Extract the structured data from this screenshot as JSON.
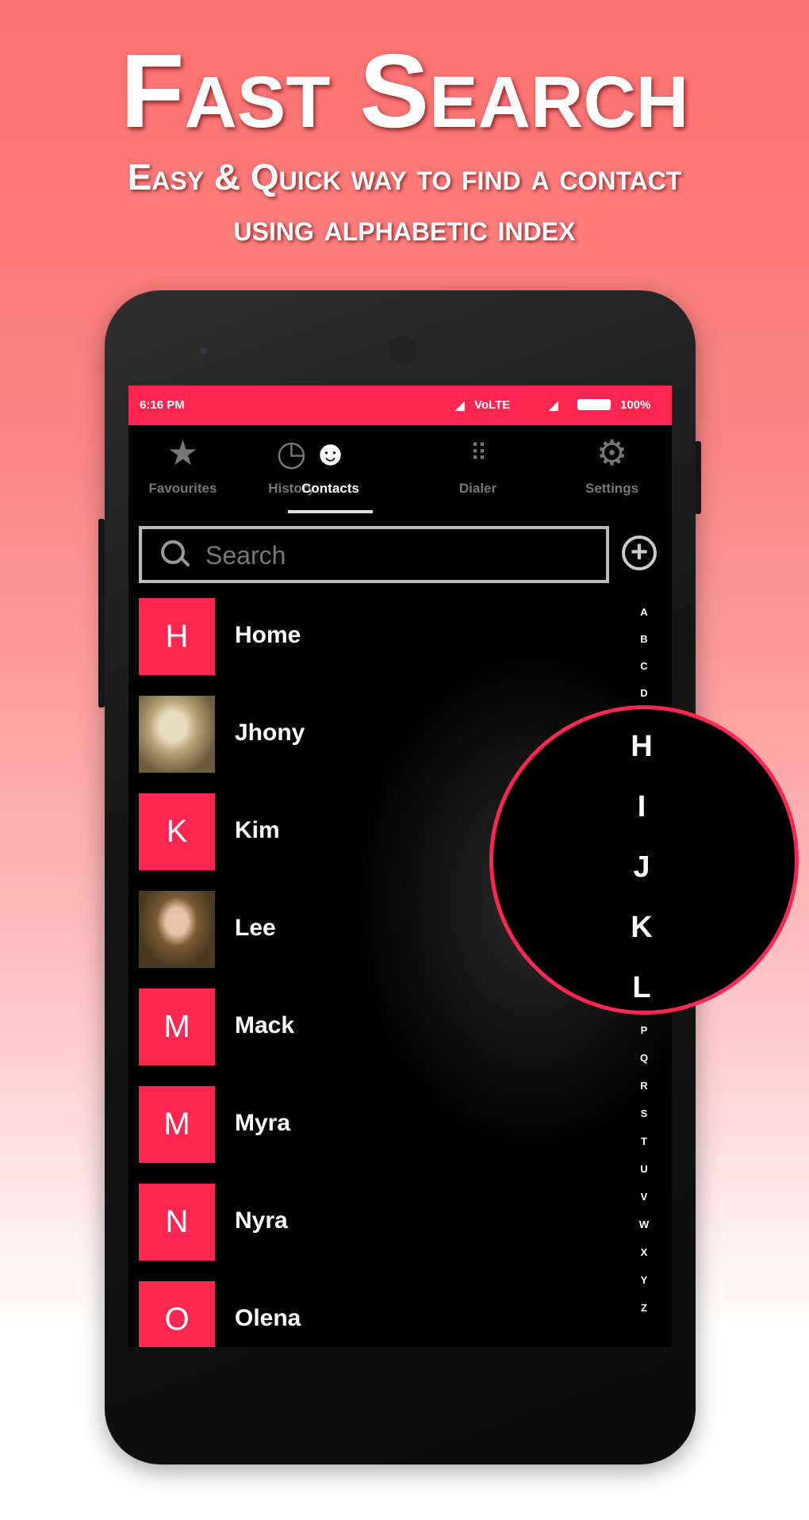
{
  "promo": {
    "title": "Fast Search",
    "subtitle_line1": "Easy & Quick way to find a contact",
    "subtitle_line2": "using alphabetic index"
  },
  "colors": {
    "accent": "#ff2652",
    "background_top": "#fb7070",
    "background_bottom": "#ffffff"
  },
  "status_bar": {
    "time": "6:16 PM",
    "network": "VoLTE",
    "battery": "100%"
  },
  "tabs": [
    {
      "label": "Favourites",
      "icon": "star-icon",
      "active": false
    },
    {
      "label": "History",
      "icon": "clock-icon",
      "active": false
    },
    {
      "label": "Contacts",
      "icon": "person-icon",
      "active": true
    },
    {
      "label": "Dialer",
      "icon": "dialpad-icon",
      "active": false
    },
    {
      "label": "Settings",
      "icon": "gear-icon",
      "active": false
    }
  ],
  "search": {
    "placeholder": "Search",
    "value": ""
  },
  "contacts": [
    {
      "name": "Home",
      "initial": "H",
      "photo": false
    },
    {
      "name": "Jhony",
      "initial": "",
      "photo": true
    },
    {
      "name": "Kim",
      "initial": "K",
      "photo": false
    },
    {
      "name": "Lee",
      "initial": "",
      "photo": true
    },
    {
      "name": "Mack",
      "initial": "M",
      "photo": false
    },
    {
      "name": "Myra",
      "initial": "M",
      "photo": false
    },
    {
      "name": "Nyra",
      "initial": "N",
      "photo": false
    },
    {
      "name": "Olena",
      "initial": "O",
      "photo": false
    }
  ],
  "index_top": [
    "A",
    "B",
    "C",
    "D"
  ],
  "index_bottom": [
    "P",
    "Q",
    "R",
    "S",
    "T",
    "U",
    "V",
    "W",
    "X",
    "Y",
    "Z"
  ],
  "index_magnified": [
    "H",
    "I",
    "J",
    "K",
    "L"
  ]
}
